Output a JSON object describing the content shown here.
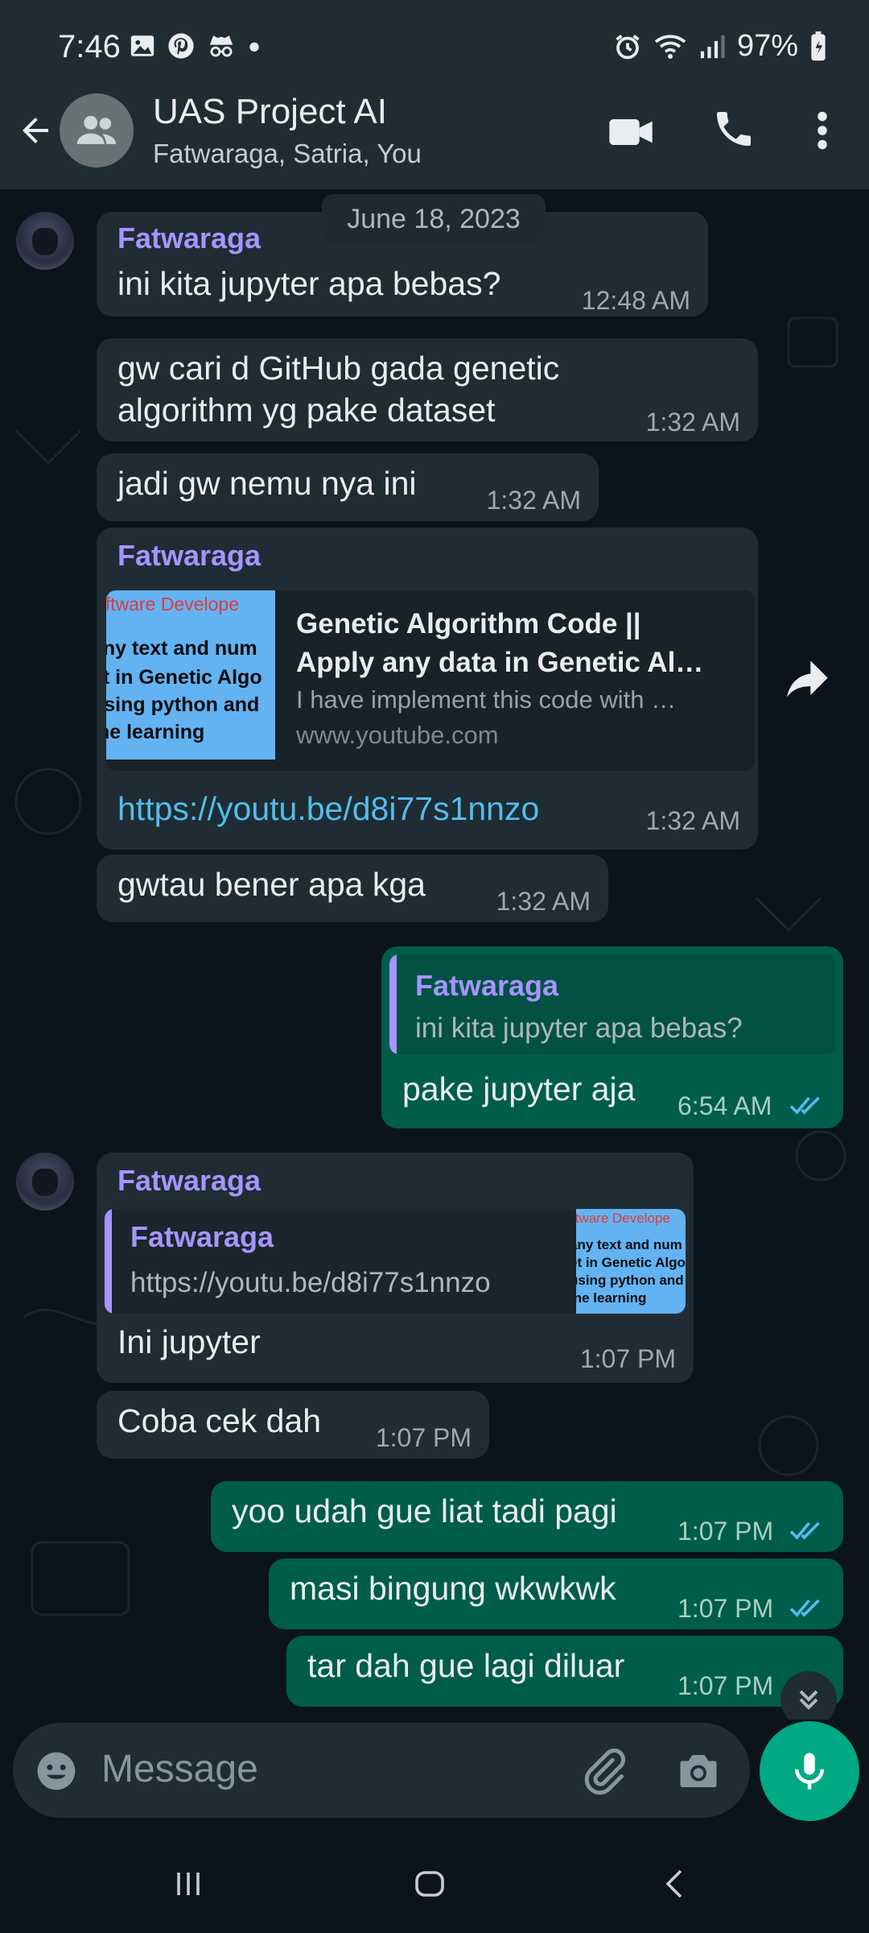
{
  "status_bar": {
    "time": "7:46",
    "battery": "97%",
    "icons": [
      "gallery-icon",
      "pinterest-icon",
      "incognito-icon",
      "dot-icon",
      "alarm-icon",
      "wifi-icon",
      "signal-icon",
      "battery-icon"
    ]
  },
  "header": {
    "title": "UAS Project AI",
    "subtitle": "Fatwaraga, Satria, You"
  },
  "chat": {
    "date_chip": "June 18, 2023",
    "messages": [
      {
        "sender": "Fatwaraga",
        "text": "ini kita jupyter apa bebas?",
        "time": "12:48 AM"
      },
      {
        "text_line1": "gw cari d GitHub gada genetic",
        "text_line2": "algorithm yg pake dataset",
        "time": "1:32 AM"
      },
      {
        "text": "jadi gw nemu nya ini",
        "time": "1:32 AM"
      },
      {
        "sender": "Fatwaraga",
        "link_title_line1": "Genetic Algorithm Code ||",
        "link_title_line2": "Apply any data in Genetic Al…",
        "link_desc": "I have implement this code with …",
        "link_domain": "www.youtube.com",
        "thumb_line1": "oftware Develope",
        "thumb_line2": "any text and num",
        "thumb_line3": "et in Genetic Algo",
        "thumb_line4": "using python and",
        "thumb_line5": "ine learning",
        "url": "https://youtu.be/d8i77s1nnzo",
        "time": "1:32 AM"
      },
      {
        "text": "gwtau bener apa kga",
        "time": "1:32 AM"
      },
      {
        "quote_sender": "Fatwaraga",
        "quote_text": "ini kita jupyter apa bebas?",
        "text": "pake jupyter aja",
        "time": "6:54 AM"
      },
      {
        "sender": "Fatwaraga",
        "quote_sender": "Fatwaraga",
        "quote_text": "https://youtu.be/d8i77s1nnzo",
        "thumb_line1": "ftware Develope",
        "thumb_line2": "any text and num",
        "thumb_line3": "et in Genetic Algo",
        "thumb_line4": "using python and",
        "thumb_line5": "ine learning",
        "text": "Ini jupyter",
        "time": "1:07 PM"
      },
      {
        "text": "Coba cek dah",
        "time": "1:07 PM"
      },
      {
        "text": "yoo udah gue liat tadi pagi",
        "time": "1:07 PM"
      },
      {
        "text": "masi bingung wkwkwk",
        "time": "1:07 PM"
      },
      {
        "text": "tar dah gue lagi diluar",
        "time": "1:07 PM"
      }
    ]
  },
  "composer": {
    "placeholder": "Message"
  },
  "colors": {
    "incoming": "#1f2c34",
    "outgoing": "#005c4b",
    "accent": "#00a884",
    "sender_name": "#a695ff",
    "link": "#53bdeb",
    "read_ticks": "#53bdeb"
  }
}
